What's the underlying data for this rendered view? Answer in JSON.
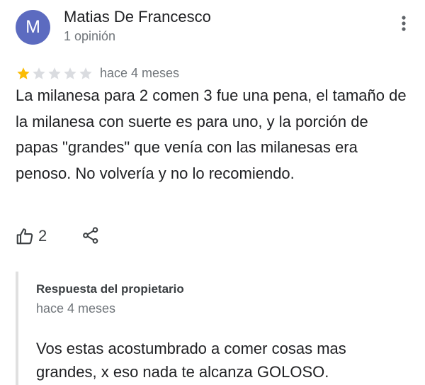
{
  "review": {
    "author": {
      "initial": "M",
      "name": "Matias De Francesco",
      "meta": "1 opinión",
      "avatar_color": "#5c6bc0"
    },
    "more_icon": "more-vert-icon",
    "rating": {
      "value": 1,
      "max": 5,
      "filled_color": "#fbbc04",
      "empty_color": "#dadce0"
    },
    "time": "hace 4 meses",
    "text": "La milanesa para 2 comen 3 fue una pena, el tamaño de la milanesa con suerte es para uno, y la porción de papas \"grandes\" que venía con las milanesas era penoso. No volvería y no lo recomiendo.",
    "likes": "2",
    "like_icon": "thumbs-up-icon",
    "share_icon": "share-icon"
  },
  "owner_response": {
    "label": "Respuesta del propietario",
    "time": "hace 4 meses",
    "text": "Vos estas acostumbrado a comer cosas mas grandes, x eso nada te alcanza GOLOSO."
  }
}
